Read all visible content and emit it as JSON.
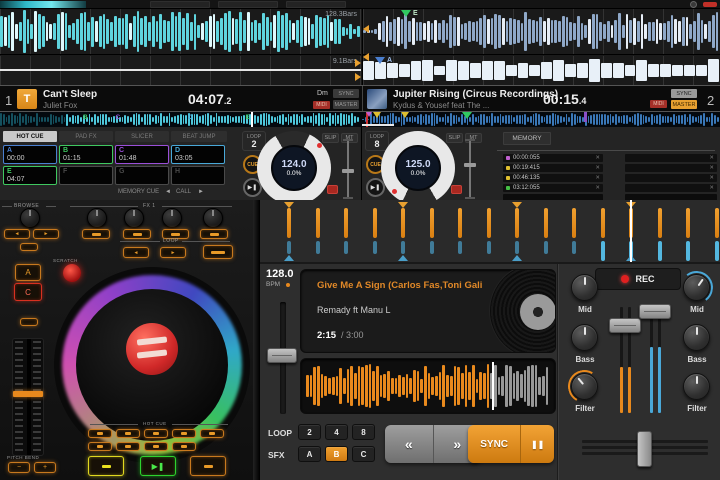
{
  "top_app": {
    "wave_labels": {
      "deck1_top": "128.3Bars",
      "deck1_mid": "9.1Bars"
    },
    "deck1": {
      "number": "1",
      "art_letter": "T",
      "title": "Can't Sleep",
      "artist": "Juliet Fox",
      "time_main": "04:07",
      "time_frac": "2",
      "key": "Dm",
      "midi_badge": "MIDI",
      "sync": "SYNC",
      "master": "MASTER",
      "loop_label": "LOOP",
      "loop_value": "2",
      "slip": "SLIP",
      "mt": "MT",
      "cue": "CUE",
      "bpm": "124.0",
      "pitch": "0.0%",
      "tabs": {
        "hot_cue": "HOT CUE",
        "pad_fx": "PAD FX",
        "slicer": "SLICER",
        "beat_jump": "BEAT JUMP"
      },
      "pads": [
        {
          "letter": "A",
          "time": "00:00",
          "color": "#4a7fd0"
        },
        {
          "letter": "B",
          "time": "01:15",
          "color": "#3fc860"
        },
        {
          "letter": "C",
          "time": "01:48",
          "color": "#9a4fd8"
        },
        {
          "letter": "D",
          "time": "03:05",
          "color": "#49a8d8"
        },
        {
          "letter": "E",
          "time": "04:07",
          "color": "#3fc860"
        },
        {
          "letter": "F",
          "time": "",
          "color": "#4a4a4a"
        },
        {
          "letter": "G",
          "time": "",
          "color": "#4a4a4a"
        },
        {
          "letter": "H",
          "time": "",
          "color": "#4a4a4a"
        }
      ],
      "markers": [
        {
          "letter": "B",
          "left": "23%",
          "color": "#3fc860"
        },
        {
          "letter": "C",
          "left": "32%",
          "color": "#9a4fd8"
        },
        {
          "letter": "D",
          "left": "52%",
          "color": "#49a8d8"
        },
        {
          "letter": "E",
          "left": "68%",
          "color": "#3fc860"
        }
      ],
      "footer": {
        "memory_cue": "MEMORY CUE",
        "prev": "◄",
        "call": "CALL",
        "next": "►"
      }
    },
    "deck2": {
      "number": "2",
      "title": "Jupiter Rising (Circus Recordings)",
      "artist": "Kydus & Yousef feat The ...",
      "time_main": "00:15",
      "time_frac": "4",
      "midi_badge": "MIDI",
      "sync": "SYNC",
      "master": "MASTER",
      "loop_label": "LOOP",
      "loop_value": "8",
      "slip": "SLIP",
      "mt": "MT",
      "cue": "CUE",
      "bpm": "125.0",
      "pitch": "0.0%",
      "wave_marker_e": "E",
      "wave_marker_a": "A",
      "memory_tab": "MEMORY",
      "memory_cues": [
        {
          "time": "00:00:055",
          "color": "#c060d0"
        },
        {
          "time": "00:19:415",
          "color": "#e0c030"
        },
        {
          "time": "00:46:135",
          "color": "#e0c030"
        },
        {
          "time": "03:12:055",
          "color": "#45c045"
        }
      ],
      "row_close": "✕"
    }
  },
  "controller": {
    "browse": "BROWSE",
    "fx": "FX 1",
    "loop": "LOOP",
    "scratch": "SCRATCH",
    "hot_cue": "HOT CUE",
    "pitch_bend": "PITCH BEND",
    "deck_a": "A",
    "deck_c": "C",
    "prev": "◄",
    "next": "►",
    "minus": "−",
    "plus": "+",
    "play_glyph": "▶❚"
  },
  "bottom_app": {
    "bpm": "128.0",
    "bpm_label": "BPM",
    "title": "Give Me A Sign (Carlos Fas,Toni Gali",
    "artist": "Remady ft Manu L",
    "time_current": "2:15",
    "time_total": "/ 3:00",
    "loop": "LOOP",
    "sfx": "SFX",
    "loop_buttons": [
      "2",
      "4",
      "8"
    ],
    "sfx_buttons": [
      "A",
      "B",
      "C"
    ],
    "rewind": "«",
    "forward": "»",
    "sync": "SYNC",
    "pause": "❚❚",
    "rec": "REC",
    "knobs": {
      "mid": "Mid",
      "bass": "Bass",
      "filter": "Filter"
    }
  }
}
